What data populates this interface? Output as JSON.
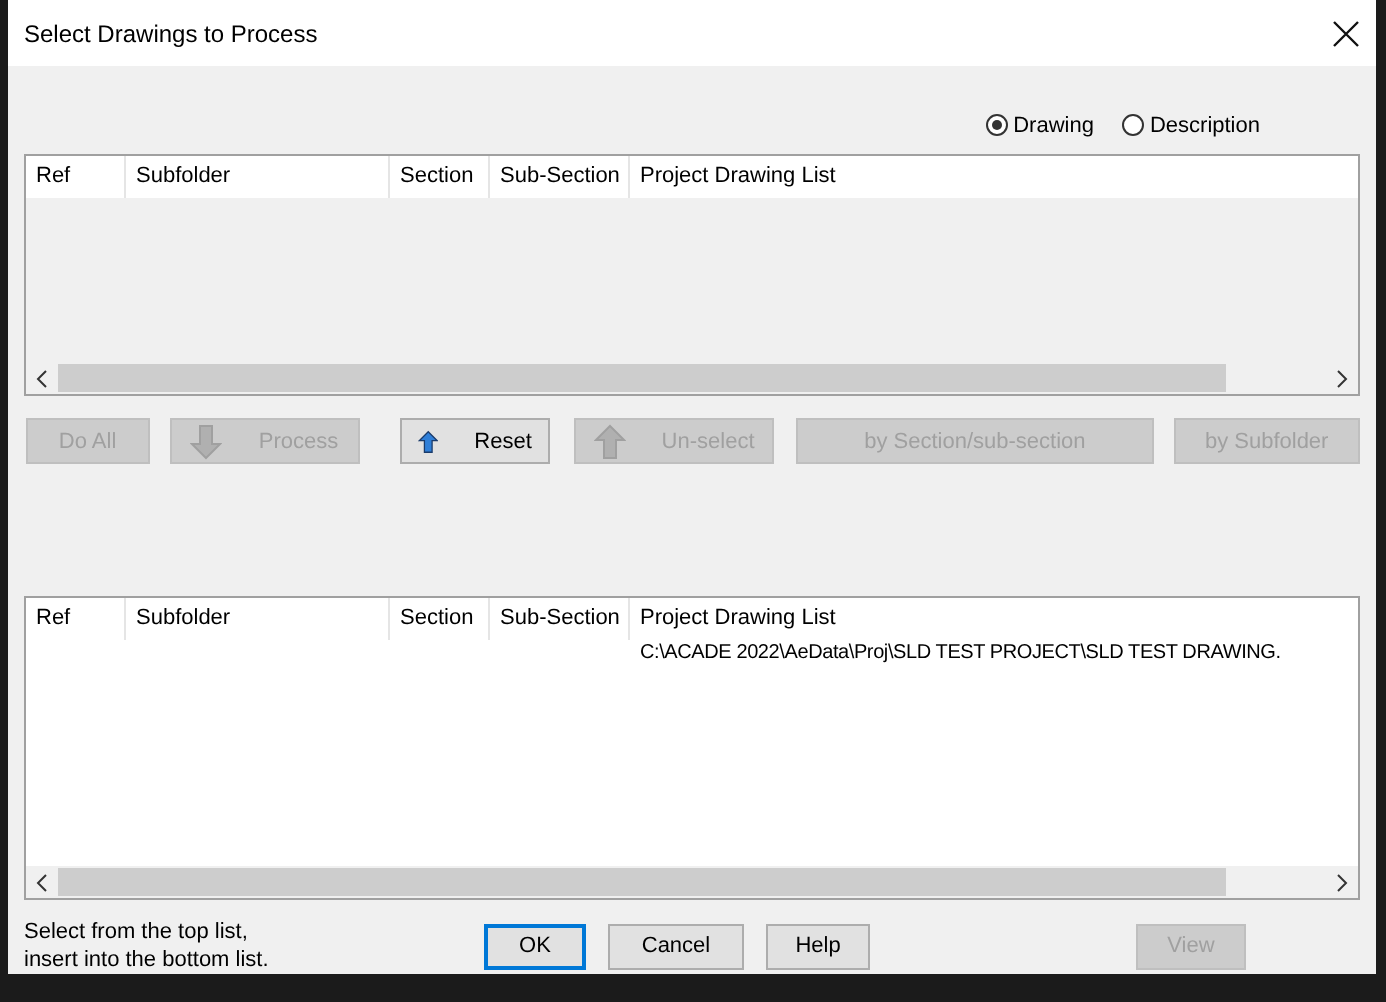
{
  "window": {
    "title": "Select Drawings to Process"
  },
  "view_options": [
    {
      "label": "Drawing",
      "selected": true
    },
    {
      "label": "Description",
      "selected": false
    }
  ],
  "top_list": {
    "columns": [
      "Ref",
      "Subfolder",
      "Section",
      "Sub-Section",
      "Project Drawing List"
    ]
  },
  "actions": [
    {
      "label": "Do All",
      "disabled": true,
      "kind": "plain"
    },
    {
      "label": "Process",
      "disabled": true,
      "kind": "move-down"
    },
    {
      "label": "Reset",
      "disabled": false,
      "kind": "move-up"
    },
    {
      "label": "Un-select",
      "disabled": true,
      "kind": "move-up"
    },
    {
      "label": "by Section/sub-section",
      "disabled": true,
      "kind": "plain"
    },
    {
      "label": "by Subfolder",
      "disabled": true,
      "kind": "plain"
    }
  ],
  "bottom_list": {
    "columns": [
      "Ref",
      "Subfolder",
      "Section",
      "Sub-Section",
      "Project Drawing List"
    ],
    "rows": [
      {
        "project_drawing_list": "C:\\ACADE 2022\\AeData\\Proj\\SLD TEST PROJECT\\SLD TEST DRAWING."
      }
    ]
  },
  "hint": "Select from the top list,\ninsert into the bottom list.",
  "dialog_buttons": [
    {
      "label": "OK",
      "disabled": false,
      "default": true
    },
    {
      "label": "Cancel",
      "disabled": false,
      "default": false
    },
    {
      "label": "Help",
      "disabled": false,
      "default": false
    },
    {
      "label": "View",
      "disabled": true,
      "default": false
    }
  ]
}
